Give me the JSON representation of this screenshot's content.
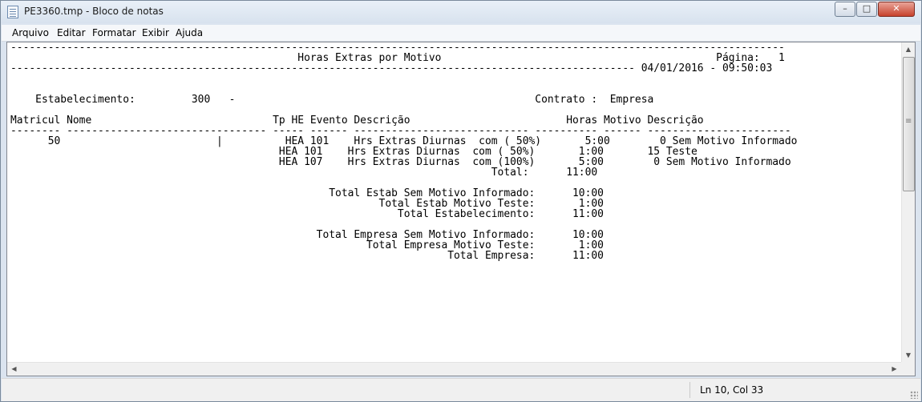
{
  "window": {
    "title": "PE3360.tmp - Bloco de notas",
    "controls": {
      "minimize": "–",
      "maximize": "□",
      "close": "✕"
    }
  },
  "menu": [
    "Arquivo",
    "Editar",
    "Formatar",
    "Exibir",
    "Ajuda"
  ],
  "document": {
    "lines": [
      "----------------------------------------------------------------------------------------------------------------------------",
      "                                              Horas Extras por Motivo                                            Página:   1",
      "---------------------------------------------------------------------------------------------------- 04/01/2016 - 09:50:03",
      "",
      "",
      "    Estabelecimento:         300   -                                                Contrato :  Empresa",
      "",
      "Matricul Nome                             Tp HE Evento Descrição                         Horas Motivo Descrição",
      "-------- -------------------------------- ----- ------ ---------------------------- ---------- ------ -----------------------",
      "      50                         |          HEA 101    Hrs Extras Diurnas  com ( 50%)       5:00        0 Sem Motivo Informado",
      "                                           HEA 101    Hrs Extras Diurnas  com ( 50%)       1:00       15 Teste",
      "                                           HEA 107    Hrs Extras Diurnas  com (100%)       5:00        0 Sem Motivo Informado",
      "                                                                             Total:      11:00",
      "",
      "                                                   Total Estab Sem Motivo Informado:      10:00",
      "                                                           Total Estab Motivo Teste:       1:00",
      "                                                              Total Estabelecimento:      11:00",
      "",
      "                                                 Total Empresa Sem Motivo Informado:      10:00",
      "                                                         Total Empresa Motivo Teste:       1:00",
      "                                                                      Total Empresa:      11:00"
    ]
  },
  "scrollbars": {
    "up": "▲",
    "down": "▼",
    "left": "◀",
    "right": "▶"
  },
  "status": {
    "position": "Ln 10, Col 33"
  }
}
